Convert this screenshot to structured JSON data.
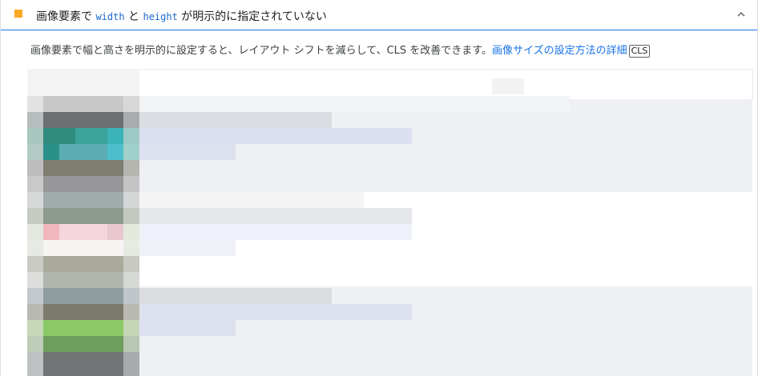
{
  "audit": {
    "title_prefix": "画像要素で ",
    "code_width": "width",
    "title_mid": " と ",
    "code_height": "height",
    "title_suffix": " が明示的に指定されていない",
    "description": "画像要素で幅と高さを明示的に設定すると、レイアウト シフトを減らして、CLS を改善できます。",
    "link_text": "画像サイズの設定方法の詳細",
    "badge": "CLS",
    "status_color": "#f9a825"
  }
}
